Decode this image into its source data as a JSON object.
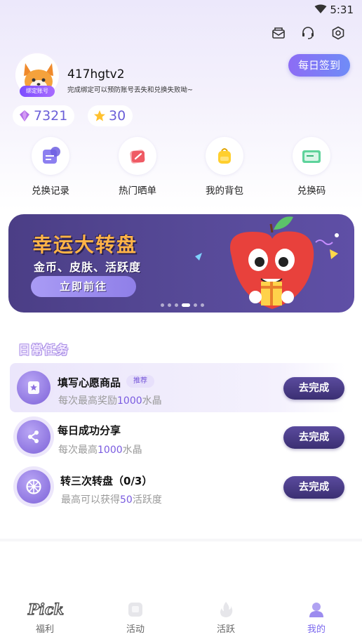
{
  "status_bar": {
    "time": "5:31"
  },
  "profile": {
    "username": "417hgtv2",
    "bind_badge": "绑定账号",
    "subtitle": "完成绑定可以预防账号丢失和兑换失败呦~",
    "checkin_label": "每日签到"
  },
  "balances": {
    "crystals": "7321",
    "stars": "30"
  },
  "shortcuts": [
    {
      "label": "兑换记录",
      "icon": "exchange-record-icon"
    },
    {
      "label": "热门晒单",
      "icon": "hot-share-icon"
    },
    {
      "label": "我的背包",
      "icon": "backpack-icon"
    },
    {
      "label": "兑换码",
      "icon": "redeem-code-icon"
    }
  ],
  "banner": {
    "title": "幸运大转盘",
    "subtitle": "金币、皮肤、活跃度",
    "button": "立即前往",
    "page_count": 6,
    "active_page": 4
  },
  "tasks": {
    "section_title": "日常任务",
    "items": [
      {
        "title": "填写心愿商品",
        "tag": "推荐",
        "desc_prefix": "每次最高奖励",
        "desc_highlight": "1000",
        "desc_suffix": "水晶",
        "button": "去完成",
        "icon": "wishlist-icon"
      },
      {
        "title": "每日成功分享",
        "tag": "",
        "desc_prefix": "每次最高",
        "desc_highlight": "1000",
        "desc_suffix": "水晶",
        "button": "去完成",
        "icon": "share-icon"
      },
      {
        "title": "转三次转盘（0/3）",
        "tag": "",
        "desc_prefix": "最高可以获得",
        "desc_highlight": "50",
        "desc_suffix": "活跃度",
        "button": "去完成",
        "icon": "wheel-icon"
      }
    ]
  },
  "bottom_nav": [
    {
      "label": "福利",
      "icon": "pick-logo-icon",
      "active": false
    },
    {
      "label": "活动",
      "icon": "activity-icon",
      "active": false
    },
    {
      "label": "活跃",
      "icon": "active-icon",
      "active": false
    },
    {
      "label": "我的",
      "icon": "profile-icon",
      "active": true
    }
  ],
  "colors": {
    "accent": "#7b68ee",
    "button_dark": "#3b2f72",
    "highlight": "#7a5be0"
  }
}
